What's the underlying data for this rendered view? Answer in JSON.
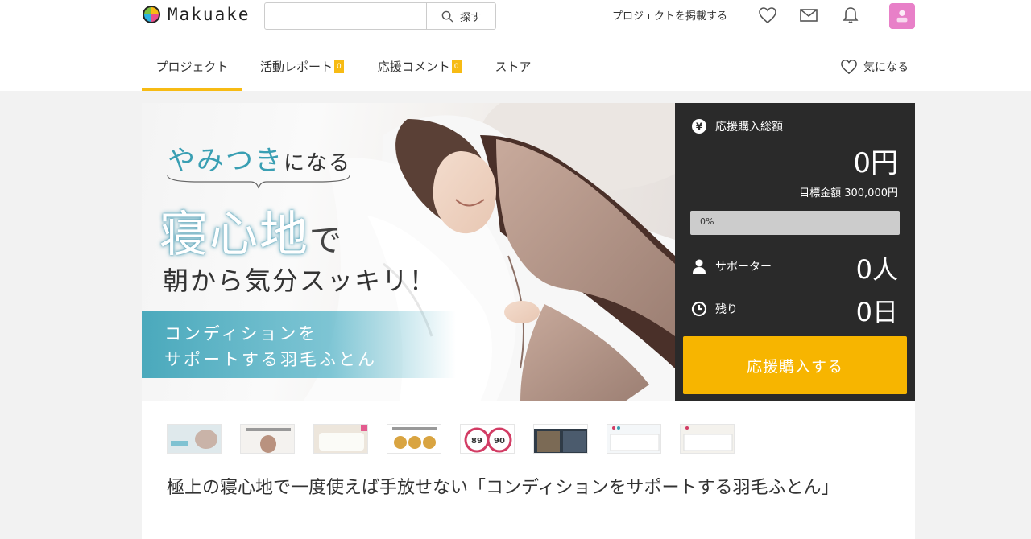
{
  "header": {
    "logo_text": "Makuake",
    "search_placeholder": "",
    "search_button": "探す",
    "post_project": "プロジェクトを掲載する",
    "icons": [
      "heart-icon",
      "mail-icon",
      "bell-icon"
    ],
    "avatar_icon": "user-avatar"
  },
  "tabs": [
    {
      "label": "プロジェクト",
      "badge": null,
      "active": true
    },
    {
      "label": "活動レポート",
      "badge": "0",
      "active": false
    },
    {
      "label": "応援コメント",
      "badge": "0",
      "active": false
    },
    {
      "label": "ストア",
      "badge": null,
      "active": false
    }
  ],
  "favorite": {
    "label": "気になる",
    "icon": "heart-icon"
  },
  "hero": {
    "line1_highlight": "やみつき",
    "line1_rest": "になる",
    "line2_main": "寝心地",
    "line2_suffix": "で",
    "line3": "朝から気分スッキリ！",
    "band_line1": "コンディションを",
    "band_line2": "サポートする羽毛ふとん"
  },
  "panel": {
    "total_label": "応援購入総額",
    "total_amount": "0円",
    "goal_text": "目標金額 300,000円",
    "progress_text": "0%",
    "progress_fraction": 0,
    "supporters_label": "サポーター",
    "supporters_value": "0人",
    "remaining_label": "残り",
    "remaining_value": "0日",
    "cta_label": "応援購入する",
    "accent_color": "#f7b500"
  },
  "thumbnails": [
    {
      "name": "thumb-1"
    },
    {
      "name": "thumb-2"
    },
    {
      "name": "thumb-3"
    },
    {
      "name": "thumb-4"
    },
    {
      "name": "thumb-5"
    },
    {
      "name": "thumb-6"
    },
    {
      "name": "thumb-7"
    },
    {
      "name": "thumb-8"
    }
  ],
  "project_title": "極上の寝心地で一度使えば手放せない「コンディションをサポートする羽毛ふとん」"
}
